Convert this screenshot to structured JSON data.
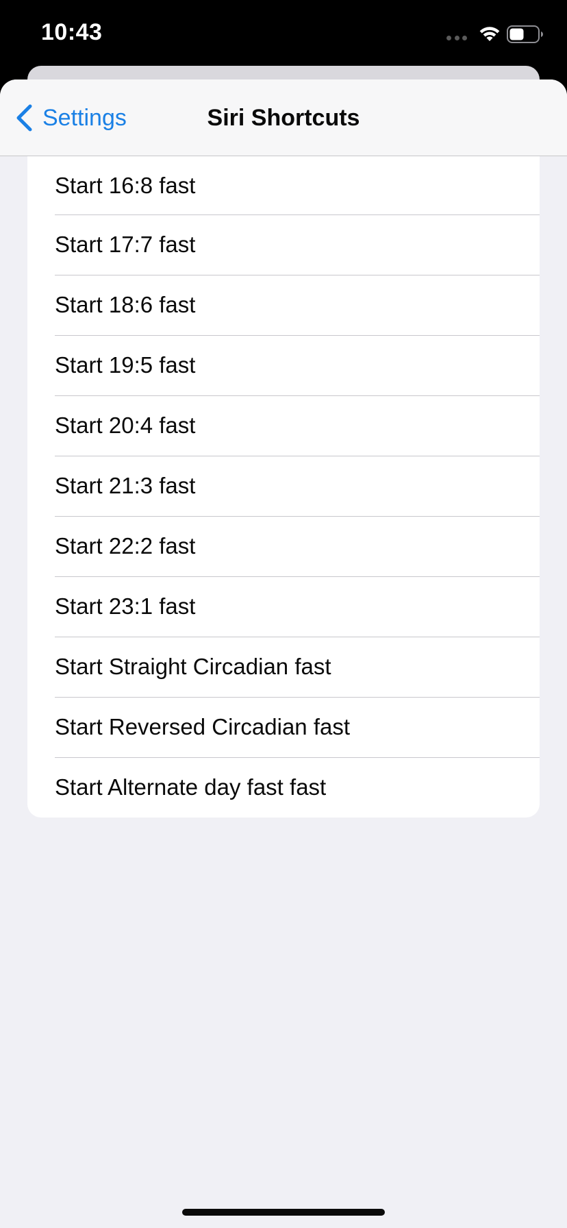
{
  "status_bar": {
    "time": "10:43"
  },
  "nav": {
    "back_label": "Settings",
    "title": "Siri Shortcuts"
  },
  "shortcuts": [
    {
      "label": "Start 16:8 fast"
    },
    {
      "label": "Start 17:7 fast"
    },
    {
      "label": "Start 18:6 fast"
    },
    {
      "label": "Start 19:5 fast"
    },
    {
      "label": "Start 20:4 fast"
    },
    {
      "label": "Start 21:3 fast"
    },
    {
      "label": "Start 22:2 fast"
    },
    {
      "label": "Start 23:1 fast"
    },
    {
      "label": "Start Straight Circadian fast"
    },
    {
      "label": "Start Reversed Circadian fast"
    },
    {
      "label": "Start Alternate day fast fast"
    }
  ],
  "icons": {
    "back": "chevron-left-icon",
    "wifi": "wifi-icon",
    "battery": "battery-icon",
    "signal": "signal-dots-icon"
  },
  "colors": {
    "accent": "#1a80e5",
    "background": "#f0f0f5",
    "card": "#ffffff",
    "separator": "#c8c7cc",
    "status_bar": "#000000"
  }
}
